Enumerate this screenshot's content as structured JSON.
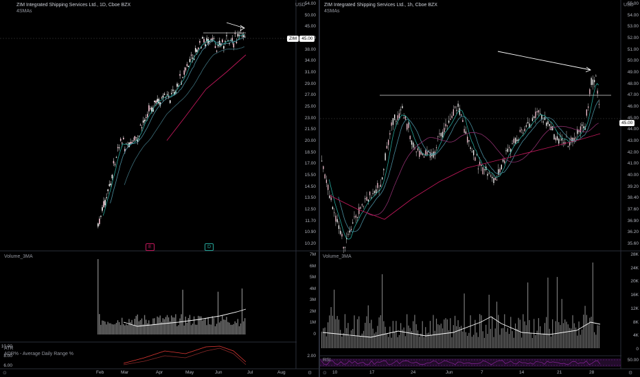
{
  "left_chart": {
    "title": "ZIM Integrated Shipping Services Ltd., 1D, Cboe BZX",
    "indicator": "4SMAs",
    "currency": "USD",
    "price_axis": [
      "54.00",
      "50.00",
      "45.00",
      "42.00",
      "38.00",
      "34.00",
      "31.00",
      "29.00",
      "27.00",
      "25.00",
      "23.00",
      "21.50",
      "20.00",
      "18.50",
      "17.00",
      "15.50",
      "14.50",
      "13.50",
      "12.50",
      "11.70",
      "10.90",
      "10.20"
    ],
    "price_tag_ticker": "ZIM",
    "price_tag_value": "45.00",
    "volume_title": "Volume_3MA",
    "volume_axis": [
      "7M",
      "6M",
      "5M",
      "4M",
      "3M",
      "2M",
      "1M",
      "0"
    ],
    "atr_title": "ATR",
    "adr_title": "ADR% - Average Daily Range %",
    "atr_axis_left": [
      "10.00",
      "8.00",
      "6.00"
    ],
    "adr_axis_right": [
      "2.00"
    ],
    "x_labels": [
      "Feb",
      "Mar",
      "Apr",
      "May",
      "Jun",
      "Jul",
      "Aug"
    ],
    "earnings_badge": "E",
    "dividend_badge": "D"
  },
  "right_chart": {
    "title": "ZIM Integrated Shipping Services Ltd., 1h, Cboe BZX",
    "indicator": "4SMAs",
    "currency": "USD",
    "price_axis": [
      "55.00",
      "54.00",
      "53.00",
      "52.00",
      "51.00",
      "50.00",
      "49.00",
      "48.00",
      "47.00",
      "46.00",
      "45.00",
      "44.00",
      "43.00",
      "42.00",
      "41.00",
      "40.00",
      "39.20",
      "38.40",
      "37.60",
      "36.90",
      "36.20",
      "35.60"
    ],
    "price_tag_value": "45.00",
    "volume_title": "Volume_3MA",
    "volume_axis": [
      "28K",
      "24K",
      "20K",
      "16K",
      "12K",
      "8K",
      "4K",
      "0"
    ],
    "rsi_title": "RSI",
    "rsi_axis": [
      "50.00"
    ],
    "x_labels": [
      "10",
      "17",
      "24",
      "Jun",
      "7",
      "14",
      "21",
      "28"
    ]
  },
  "colors": {
    "up": "#ffffff",
    "down": "#f7c5d4",
    "sma_fast": "#26a69a",
    "sma_slow": "#c2185b",
    "volume": "#7a7a7a",
    "volume_ma": "#ffffff",
    "atr": "#e53935",
    "rsi": "#9c27b0"
  }
}
